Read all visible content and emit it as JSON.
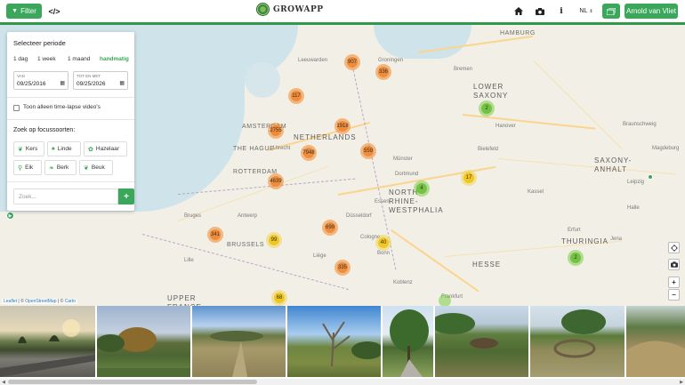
{
  "app": {
    "title": "GROWAPP",
    "filter_label": "Filter",
    "code_icon": "code-icon",
    "language": "NL",
    "user": "Arnold van Vliet"
  },
  "colors": {
    "accent": "#3aa75a",
    "cluster_orange": "#f08732",
    "cluster_yellow": "#f0c20c",
    "cluster_green": "#6ebe3c"
  },
  "panel": {
    "title": "Selecteer periode",
    "periods": [
      "1 dag",
      "1 week",
      "1 maand",
      "handmatig"
    ],
    "active_period": "handmatig",
    "from_label": "VAN",
    "from_value": "09/25/2016",
    "to_label": "TOT EN MET",
    "to_value": "09/25/2026",
    "timelapse_label": "Toon alleen time-lapse video's",
    "focus_title": "Zoek op focussoorten:",
    "species": [
      "Kers",
      "Linde",
      "Hazelaar",
      "Eik",
      "Berk",
      "Beuk"
    ],
    "search_placeholder": "Zoek...",
    "add_label": "+"
  },
  "map": {
    "labels": {
      "countries": [
        "NETHERLANDS",
        "LOWER SAXONY",
        "NORTH RHINE-WESTPHALIA",
        "SAXONY-ANHALT",
        "THURINGIA",
        "HESSE",
        "UPPER FRANCE",
        "BRUSSELS"
      ],
      "cities": [
        "HAMBURG",
        "Leeuwarden",
        "Groningen",
        "Bremen",
        "AMSTERDAM",
        "Hanover",
        "Braunschweig",
        "THE HAGUE",
        "Utrecht",
        "Münster",
        "Bielefeld",
        "Magdeburg",
        "ROTTERDAM",
        "Dortmund",
        "Leipzig",
        "Essen",
        "Kassel",
        "Halle",
        "Bruges",
        "Antwerp",
        "Düsseldorf",
        "Erfurt",
        "Jena",
        "Lille",
        "Cologne",
        "Liège",
        "Bonn",
        "Koblenz",
        "Frankfurt"
      ]
    },
    "clusters": [
      {
        "count": "907",
        "color": "orange"
      },
      {
        "count": "336",
        "color": "orange"
      },
      {
        "count": "117",
        "color": "orange"
      },
      {
        "count": "2755",
        "color": "orange"
      },
      {
        "count": "1918",
        "color": "orange"
      },
      {
        "count": "7948",
        "color": "orange"
      },
      {
        "count": "559",
        "color": "orange"
      },
      {
        "count": "4639",
        "color": "orange"
      },
      {
        "count": "341",
        "color": "orange"
      },
      {
        "count": "699",
        "color": "orange"
      },
      {
        "count": "335",
        "color": "orange"
      },
      {
        "count": "99",
        "color": "yellow"
      },
      {
        "count": "40",
        "color": "yellow"
      },
      {
        "count": "17",
        "color": "yellow"
      },
      {
        "count": "68",
        "color": "yellow"
      },
      {
        "count": "2",
        "color": "green"
      },
      {
        "count": "4",
        "color": "green"
      },
      {
        "count": "2",
        "color": "green"
      }
    ],
    "attribution": {
      "leaflet": "Leaflet",
      "sep1": "| ©",
      "osm": "OpenStreetMap",
      "sep2": "| ©",
      "carto": "Carto"
    },
    "zoom_in": "+",
    "zoom_out": "−"
  },
  "thumbnails": [
    {
      "name": "park-road-sunset"
    },
    {
      "name": "park-trees-bench"
    },
    {
      "name": "dry-field-shrubs"
    },
    {
      "name": "dead-tree-meadow"
    },
    {
      "name": "tree-path"
    },
    {
      "name": "pond-reeds"
    },
    {
      "name": "dry-pond-ring"
    },
    {
      "name": "sandy-bank"
    }
  ]
}
